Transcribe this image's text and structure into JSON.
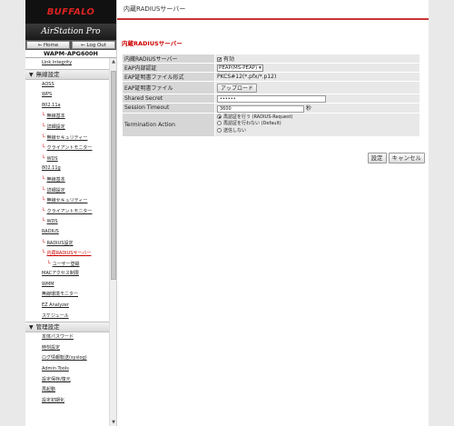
{
  "brand": {
    "logo": "BUFFALO",
    "product": "AirStation Pro",
    "model": "WAPM-APG600H"
  },
  "nav_buttons": {
    "home": "Home",
    "logout": "Log Out"
  },
  "sidebar": {
    "truncated_item": "Link Integrity",
    "wireless_section": "無線設定",
    "aoss": "AOSS",
    "wps": "WPS",
    "band_a": "802.11a",
    "a_basic": "無線基本",
    "a_detail": "詳細設定",
    "a_security": "無線セキュリティー",
    "a_client_monitor": "クライアントモニター",
    "a_wds": "WDS",
    "band_g": "802.11g",
    "g_basic": "無線基本",
    "g_detail": "詳細設定",
    "g_security": "無線セキュリティー",
    "g_client_monitor": "クライアントモニター",
    "g_wds": "WDS",
    "radius": "RADIUS",
    "radius_settings": "RADIUS設定",
    "internal_radius": "内蔵RADIUSサーバー",
    "user_mgmt": "ユーザー登録",
    "mac_access": "MACアクセス制限",
    "wmm": "WMM",
    "env_monitor": "無線環境モニター",
    "ez_analyzer": "EZ Analyzer",
    "schedule": "スケジュール",
    "admin_section": "管理設定",
    "password": "本体パスワード",
    "time": "時刻設定",
    "syslog": "ログ情報転送(syslog)",
    "admin_tools": "Admin Tools",
    "save_restore": "設定保存/復元",
    "reboot": "再起動",
    "init": "設定初期化"
  },
  "content": {
    "header_title": "内蔵RADIUSサーバー",
    "section_title": "内蔵RADIUSサーバー",
    "rows": {
      "server_label": "内蔵RADIUSサーバー",
      "server_value": "有効",
      "eap_auth_label": "EAP内部認証",
      "eap_auth_value": "PEAP(MS-PEAP)",
      "cert_format_label": "EAP証明書ファイル形式",
      "cert_format_value": "PKCS#12(*.pfx/*.p12)",
      "cert_file_label": "EAP証明書ファイル",
      "upload_button": "アップロード",
      "secret_label": "Shared Secret",
      "secret_value": "••••••",
      "timeout_label": "Session Timeout",
      "timeout_value": "3600",
      "timeout_unit": "秒",
      "termination_label": "Termination Action",
      "term_opt1": "再認証を行う (RADIUS-Request)",
      "term_opt2": "再認証を行わない (Default)",
      "term_opt3": "送信しない"
    },
    "set_button": "設定",
    "cancel_button": "キャンセル"
  }
}
